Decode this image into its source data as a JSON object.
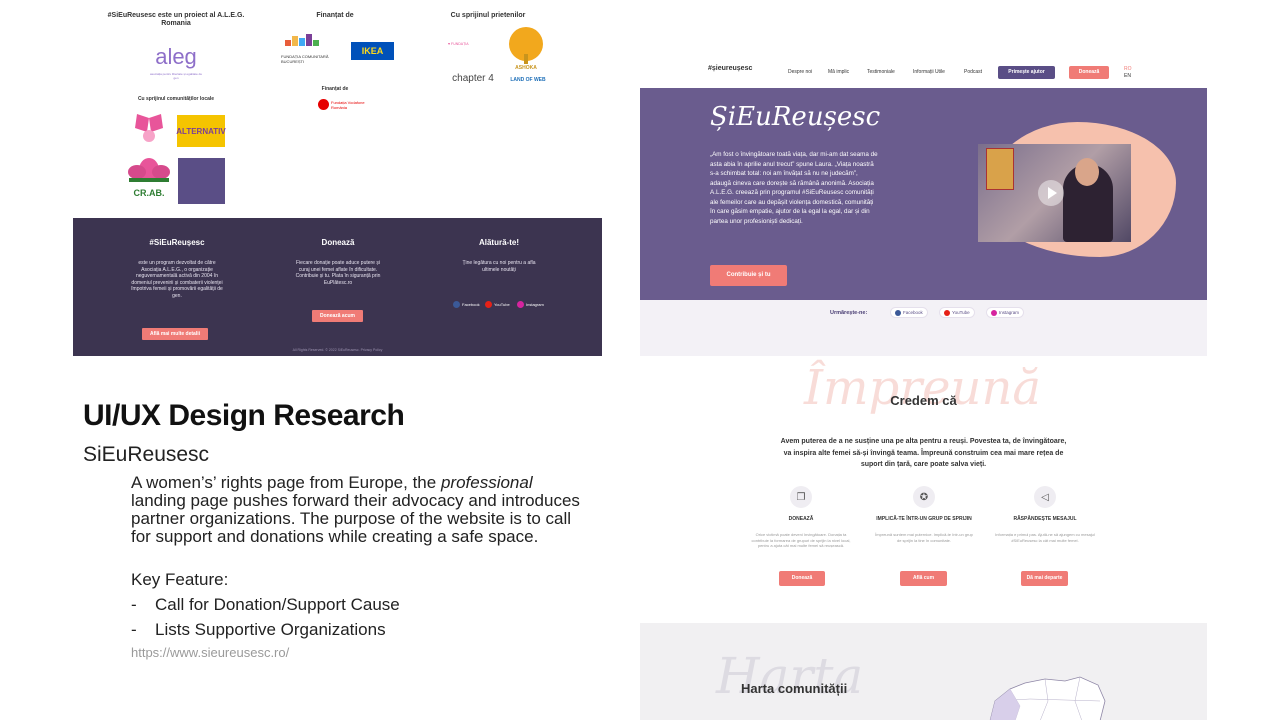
{
  "slide": {
    "title": "UI/UX Design Research",
    "subtitle": "SiEuReusesc",
    "description_pre": "A women’s’ rights page from Europe, the ",
    "description_em": "professional",
    "description_post": " landing page pushes forward their advocacy and introduces partner organizations. The purpose of the website is to call for support and donations while creating a safe space.",
    "key_feature_label": "Key Feature:",
    "bullets": [
      {
        "dash": "-",
        "text": "Call for Donation/Support Cause"
      },
      {
        "dash": "-",
        "text": "Lists Supportive Organizations"
      }
    ],
    "url": "https://www.sieureusesc.ro/"
  },
  "left_shot": {
    "col1_title": "#SiEuReusesc este un proiect al A.L.E.G. Romania",
    "aleg_logo": "aleg",
    "aleg_sub": "asociația pentru libertate și egalitate de gen",
    "col1_sub": "Cu sprijinul comunităților locale",
    "alternativ_logo": "ALTERNATIV",
    "crab_logo": "CR.AB.",
    "col2_title": "Finanțat de",
    "fcb_logo": "FUNDAȚIA COMUNITARĂ BUCUREȘTI",
    "ikea_logo": "IKEA",
    "col2_sub": "Finanțat de",
    "vodafone_logo": "Fundația Vodafone România",
    "col3_title": "Cu sprijinul prietenilor",
    "ashoka_logo": "ASHOKA",
    "chapter_logo": "chapter 4",
    "landweb_logo": "LAND OF WEB",
    "footer": {
      "col1_title": "#SiEuReușesc",
      "col1_text": "este un program dezvoltat de către Asociația A.L.E.G., o organizație neguvernamentală activă din 2004 în domeniul prevenirii și combaterii violenței împotriva femeii și promovării egalității de gen.",
      "col1_btn": "Află mai multe detalii",
      "col2_title": "Donează",
      "col2_text": "Fiecare donație poate aduce putere și curaj unei femei aflate în dificultate. Contribuie și tu. Plata în siguranță prin EuPlătesc.ro",
      "col2_btn": "Donează acum",
      "col3_title": "Alătură-te!",
      "col3_text": "Ține legătura cu noi pentru a afla ultimele noutăți",
      "social": [
        "Facebook",
        "YouTube",
        "Instagram"
      ],
      "copyright": "All Rights Reserved. © 2022 SiEuReusesc. Privacy Policy"
    }
  },
  "rt_shot": {
    "logo": "#șieureușesc",
    "nav": [
      "Despre noi",
      "Mă implic",
      "Testimoniale",
      "Informații Utile",
      "Podcast"
    ],
    "btn_help": "Primește ajutor",
    "btn_donate": "Donează",
    "lang_ro": "RO",
    "lang_en": "EN",
    "hero_title": "ȘiEuReușesc",
    "hero_text": "„Am fost o învingătoare toată viața, dar mi-am dat seama de asta abia în aprilie anul trecut” spune Laura. „Viața noastră s-a schimbat total: noi am învățat să nu ne judecăm”, adaugă cineva care dorește să rămână anonimă. Asociația A.L.E.G. creează prin programul #SiEuReusesc comunități ale femeilor care au depășit violența domestică, comunități în care găsim empatie, ajutor de la egal la egal, dar și din partea unor profesioniști dedicați.",
    "hero_btn": "Contribuie și tu",
    "follow_label": "Urmărește-ne:",
    "social": [
      "Facebook",
      "YouTube",
      "Instagram"
    ]
  },
  "rb_shot": {
    "script": "Împreună",
    "title": "Credem că",
    "lead": "Avem puterea de a ne susține una pe alta pentru a reuși. Povestea ta, de învingătoare, va inspira alte femei să-și învingă teama. Împreună construim cea mai mare rețea de suport din țară, care poate salva vieți.",
    "cards": [
      {
        "title": "DONEAZĂ",
        "text": "Orice victimă poate deveni învingătoare. Donația ta contribuie la formarea de grupuri de sprijin la nivel local, pentru a ajuta cât mai multe femei să reușească.",
        "btn": "Donează",
        "icon": "❐"
      },
      {
        "title": "IMPLICĂ-TE ÎNTR-UN GRUP DE SPRIJIN",
        "text": "Împreună suntem mai puternice. Implică-te într-un grup de sprijin la tine în comunitate.",
        "btn": "Află cum",
        "icon": "✪"
      },
      {
        "title": "RĂSPÂNDEȘTE MESAJUL",
        "text": "Informația e primul pas. Ajută-ne să ajungem cu mesajul #SiEuReusesc la cât mai multe femei.",
        "btn": "Dă mai departe",
        "icon": "◁"
      }
    ],
    "map_script": "Harta",
    "map_title": "Harta comunității"
  }
}
